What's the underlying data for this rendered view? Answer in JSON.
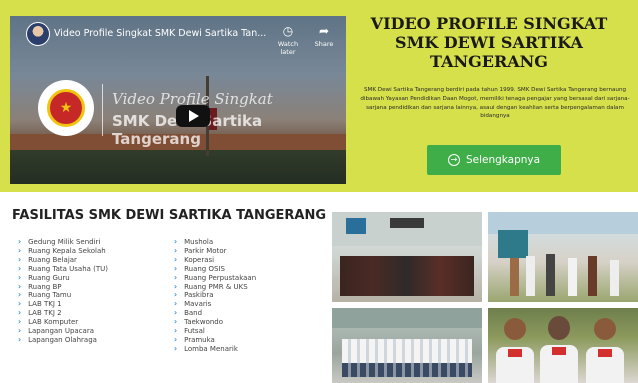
{
  "video": {
    "title": "Video Profile Singkat SMK Dewi Sartika Tan...",
    "watch_later": "Watch later",
    "share": "Share",
    "overlay_line1": "Video Profile Singkat",
    "overlay_line2": "SMK Dewi Sartika Tangerang"
  },
  "hero": {
    "title_lines": [
      "VIDEO PROFILE SINGKAT",
      "SMK DEWI SARTIKA",
      "TANGERANG"
    ],
    "description": "SMK Dewi Sartika Tangerang berdiri pada tahun 1999. SMK Dewi Sartika Tangerang bernaung dibawah Yayasan Pendidikan Daan Mogot, memiliki tenaga pengajar yang bersasal dari sarjana-sarjana pendidikan dan sarjana lainnya, asaui dengan keahlian serta berpengalaman dalam bidangnya",
    "button": "Selengkapnya",
    "bg_color": "#d6e04a",
    "button_color": "#3fae48"
  },
  "facilities": {
    "title": "FASILITAS SMK DEWI SARTIKA TANGERANG",
    "col1": [
      "Gedung Milik Sendiri",
      "Ruang Kepala Sekolah",
      "Ruang Belajar",
      "Ruang Tata Usaha (TU)",
      "Ruang Guru",
      "Ruang BP",
      "Ruang Tamu",
      "LAB TKJ 1",
      "LAB TKJ 2",
      "LAB Komputer",
      "Lapangan Upacara",
      "Lapangan Olahraga"
    ],
    "col2": [
      "Mushola",
      "Parkir Motor",
      "Koperasi",
      "Ruang OSIS",
      "Ruang Perpustakaan",
      "Ruang PMR & UKS",
      "Paskibra",
      "Mavaris",
      "Band",
      "Taekwondo",
      "Futsal",
      "Pramuka",
      "Lomba Menarik"
    ]
  },
  "icons": {
    "play": "play-icon",
    "clock": "clock-icon",
    "share": "share-icon",
    "chevron": "chevron-right-icon",
    "arrow_circle": "arrow-circle-right-icon"
  }
}
